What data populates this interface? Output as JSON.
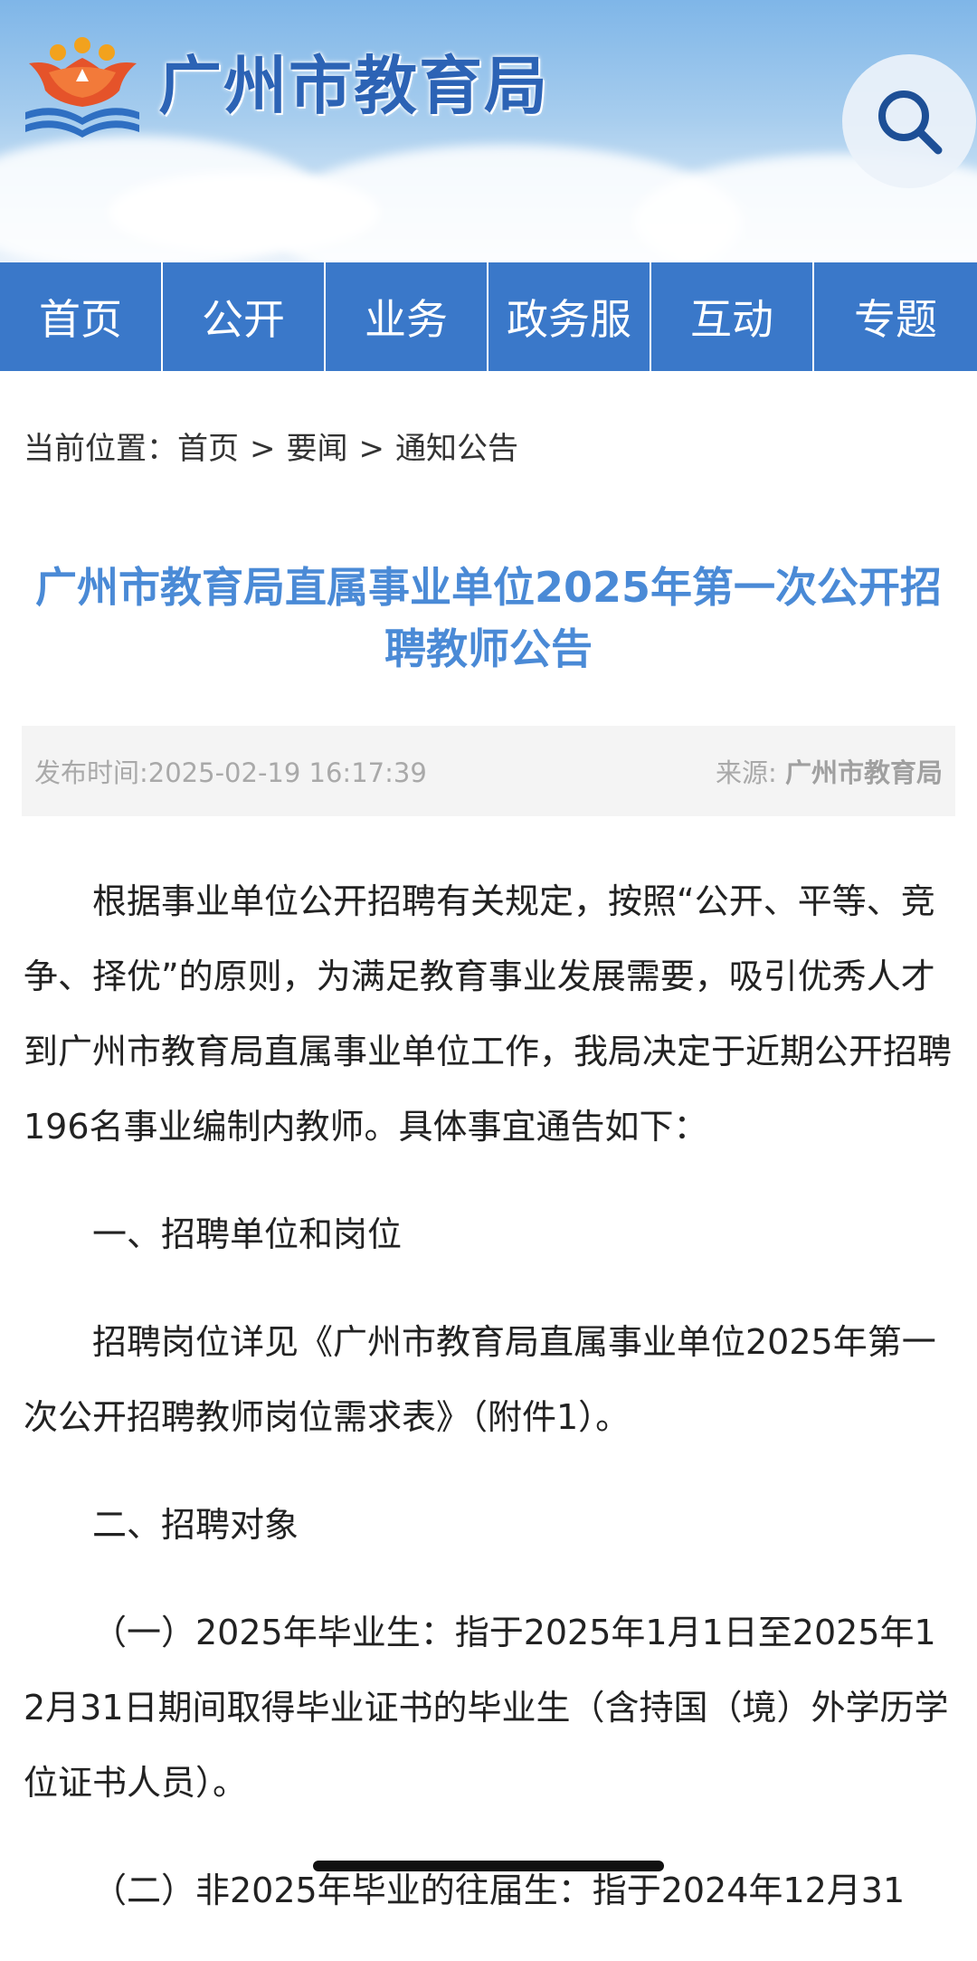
{
  "header": {
    "site_title": "广州市教育局",
    "logo_icon": "education-bureau-logo",
    "search_icon": "search-icon"
  },
  "nav": {
    "items": [
      {
        "label": "首页"
      },
      {
        "label": "公开"
      },
      {
        "label": "业务"
      },
      {
        "label": "政务服"
      },
      {
        "label": "互动"
      },
      {
        "label": "专题"
      }
    ]
  },
  "breadcrumb": {
    "prefix": "当前位置：",
    "items": [
      "首页",
      "要闻",
      "通知公告"
    ],
    "separator": ">"
  },
  "article": {
    "title": "广州市教育局直属事业单位2025年第一次公开招聘教师公告",
    "publish_time": "发布时间:2025-02-19 16:17:39",
    "source_label": "来源:",
    "source_value": "广州市教育局",
    "paragraphs": [
      "根据事业单位公开招聘有关规定，按照“公开、平等、竞争、择优”的原则，为满足教育事业发展需要，吸引优秀人才到广州市教育局直属事业单位工作，我局决定于近期公开招聘196名事业编制内教师。具体事宜通告如下：",
      "一、招聘单位和岗位",
      "招聘岗位详见《广州市教育局直属事业单位2025年第一次公开招聘教师岗位需求表》（附件1）。",
      "二、招聘对象",
      "（一）2025年毕业生：指于2025年1月1日至2025年12月31日期间取得毕业证书的毕业生（含持国（境）外学历学位证书人员）。",
      "（二）非2025年毕业的往届生：指于2024年12月31"
    ]
  },
  "colors": {
    "nav_bg": "#3a78c9",
    "title_color": "#4a8ad6",
    "site_title_color": "#2c63b5"
  }
}
